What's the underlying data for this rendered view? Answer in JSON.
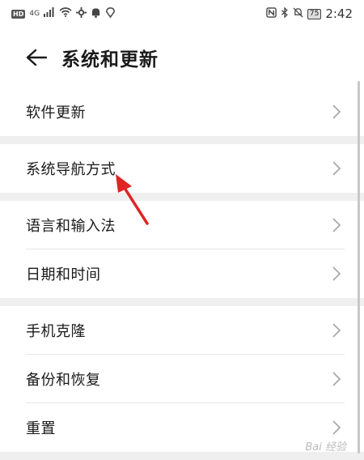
{
  "status_bar": {
    "left_icons": [
      "hd-badge",
      "signal-4g",
      "wifi",
      "settings",
      "notification-bell",
      "location"
    ],
    "hd_label": "HD",
    "net_label": "4G",
    "battery_level": "75",
    "time": "2:42"
  },
  "header": {
    "title": "系统和更新"
  },
  "sections": [
    {
      "items": [
        {
          "label": "软件更新"
        }
      ]
    },
    {
      "items": [
        {
          "label": "系统导航方式"
        }
      ]
    },
    {
      "items": [
        {
          "label": "语言和输入法"
        },
        {
          "label": "日期和时间"
        }
      ]
    },
    {
      "items": [
        {
          "label": "手机克隆"
        },
        {
          "label": "备份和恢复"
        },
        {
          "label": "重置"
        }
      ]
    }
  ],
  "watermark": "Bai 经验",
  "colors": {
    "background": "#efefef",
    "card": "#ffffff",
    "annotation_arrow": "#e02424",
    "chevron": "#aaaaaa"
  }
}
